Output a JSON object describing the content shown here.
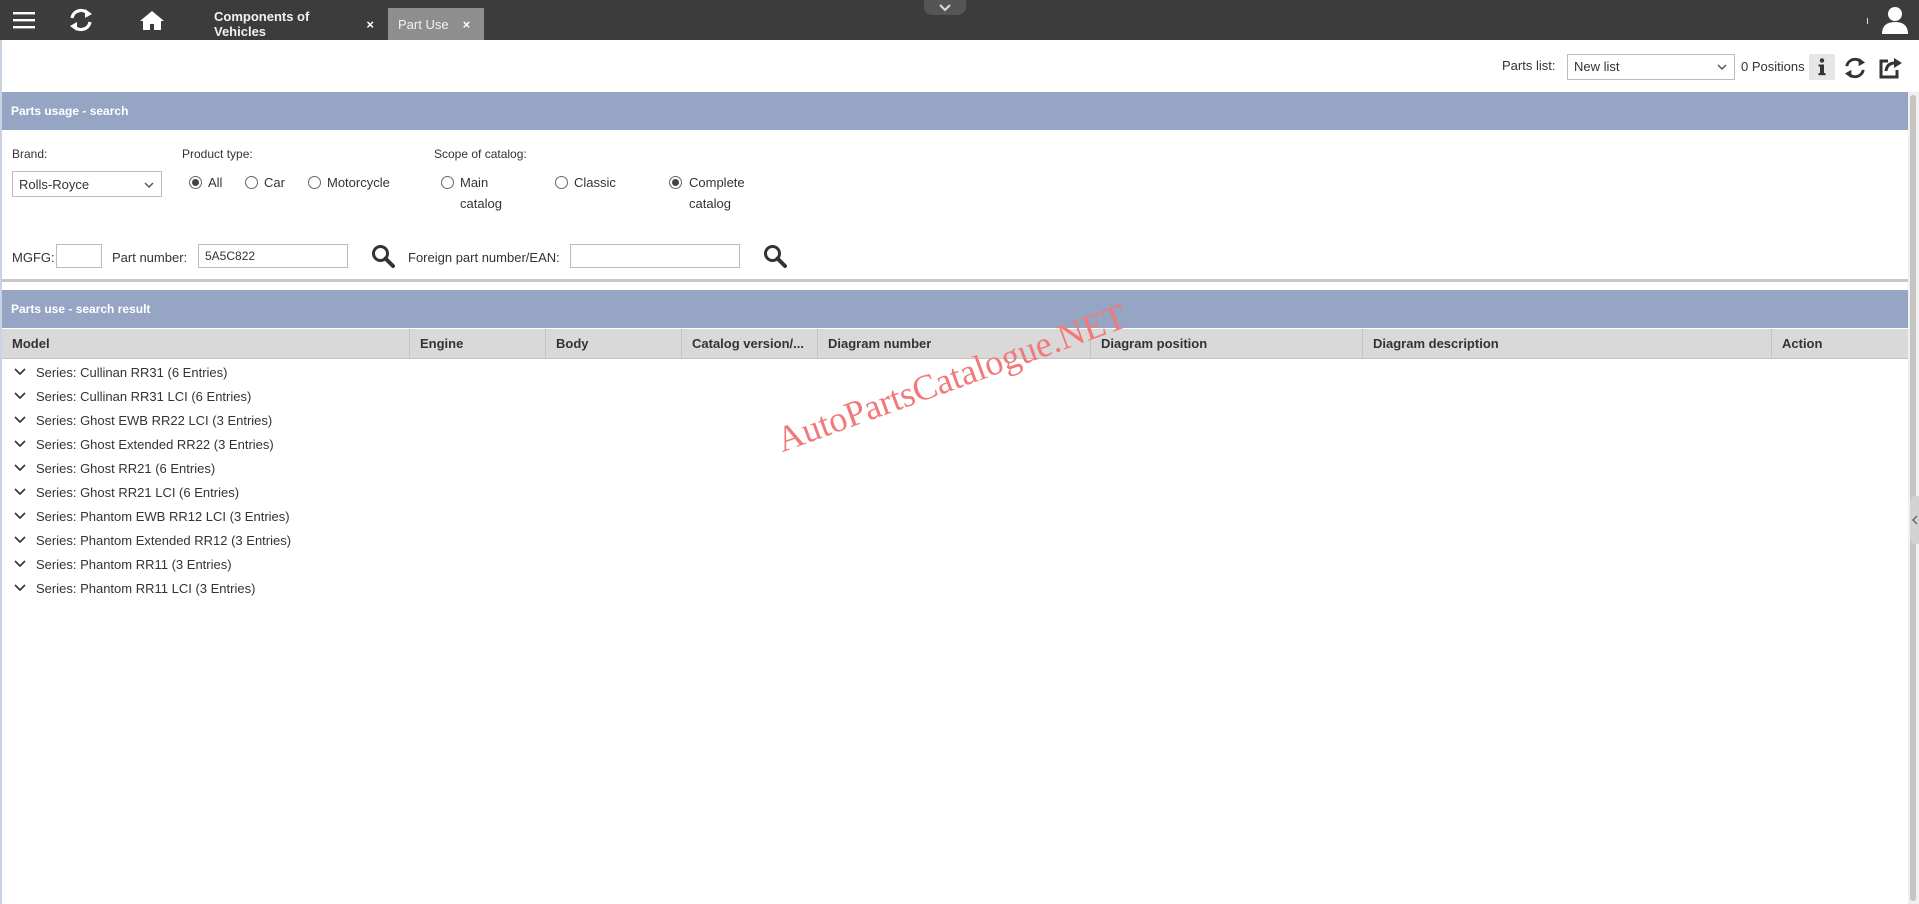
{
  "topbar": {
    "tabs": [
      {
        "label": "Components of Vehicles",
        "close": "×"
      },
      {
        "label": "Part Use",
        "close": "×"
      }
    ]
  },
  "partslist": {
    "label": "Parts list:",
    "selected": "New list",
    "positions": "0 Positions"
  },
  "search": {
    "header": "Parts usage - search",
    "brand_label": "Brand:",
    "brand_value": "Rolls-Royce",
    "product_type_label": "Product type:",
    "product_types": [
      "All",
      "Car",
      "Motorcycle"
    ],
    "product_type_selected": "All",
    "scope_label": "Scope of catalog:",
    "scopes": [
      {
        "line1": "Main",
        "line2": "catalog"
      },
      {
        "line1": "Classic",
        "line2": ""
      },
      {
        "line1": "Complete",
        "line2": "catalog"
      }
    ],
    "scope_selected": "Complete catalog",
    "mgfg_label": "MGFG:",
    "mgfg_value": "",
    "part_number_label": "Part number:",
    "part_number_value": "5A5C822",
    "foreign_label": "Foreign part number/EAN:",
    "foreign_value": ""
  },
  "results": {
    "header": "Parts use - search result",
    "columns": [
      "Model",
      "Engine",
      "Body",
      "Catalog version/...",
      "Diagram number",
      "Diagram position",
      "Diagram description",
      "Action"
    ],
    "rows": [
      "Series: Cullinan RR31 (6 Entries)",
      "Series: Cullinan RR31 LCI (6 Entries)",
      "Series: Ghost EWB RR22 LCI (3 Entries)",
      "Series: Ghost Extended RR22 (3 Entries)",
      "Series: Ghost RR21 (6 Entries)",
      "Series: Ghost RR21 LCI (6 Entries)",
      "Series: Phantom EWB RR12 LCI (3 Entries)",
      "Series: Phantom Extended RR12 (3 Entries)",
      "Series: Phantom RR11 (3 Entries)",
      "Series: Phantom RR11 LCI (3 Entries)"
    ]
  },
  "watermark": "AutoPartsCatalogue.NET",
  "colors": {
    "topbar": "#3c3c3c",
    "section_header": "#95a5c3",
    "table_header": "#d9d9d9",
    "watermark": "#f07a7a"
  }
}
